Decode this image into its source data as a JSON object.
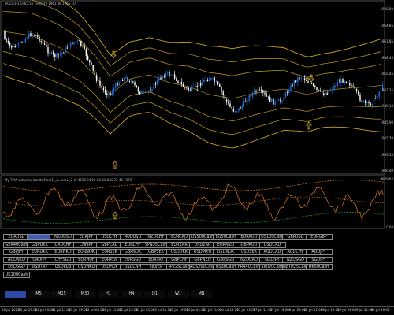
{
  "main_chart": {
    "title": "GOLD,H1 1965.56 1965.59 1963.88 1965.10",
    "price_scale": [
      "1968.00",
      "1964.85",
      "1961.85",
      "1958.45",
      "1955.45",
      "1952.25",
      "1949.10",
      "1945.90",
      "1942.70",
      "1939.55",
      "1936.40"
    ]
  },
  "indicator": {
    "title": "My TMA extremal bands Mod(1)_w Arrow_2 |0.4618 84.10 84.01 8.6272 45.7397",
    "scale": [
      "99.5802",
      "0.00"
    ]
  },
  "symbols": [
    "EURUSD",
    "GBPUSD",
    "NZDUSD",
    "EURJPY",
    "USDCHF",
    "AUDUSD",
    "NZDCHF",
    "EURCAD",
    "US500Cash",
    "EU50Cash",
    "EURAUD",
    "US100Cash",
    "GBPUSD",
    "EURGBP",
    "GER40Cash",
    "GBPDKK",
    "CADCHF",
    "CHFJPY",
    "GBPCAD",
    "EURCHF",
    "SPN35Cash",
    "EURZAR",
    "USDZAR",
    "EURNZD",
    "GBPAUD",
    "USDCAD",
    "GBPJPY",
    "EURDKK",
    "EURHKD",
    "EURNOK",
    "EURSEK",
    "GBPNOK",
    "GBPSEK",
    "USDDKK",
    "USDMXN",
    "USDNOK",
    "USDSEK",
    "AUDCAD",
    "AUDCHF",
    "AUDJPY",
    "AUDNZD",
    "CADJPY",
    "CHFSGD",
    "EURHUF",
    "EURPLN",
    "EURSGD",
    "EURTRY",
    "GBPCHF",
    "GBPNZD",
    "GBPSGD",
    "NZDCAD",
    "NZDJPY",
    "NZDSGD",
    "SGDJPY",
    "USDSGD",
    "USDTRY",
    "USDPLN",
    "USDHKD",
    "USDHUF",
    "USDCNH",
    "SILVER",
    "JP225Cash",
    "AUS200Cash",
    "US30Cash",
    "FRA40Cash",
    "SWI20Cash",
    "NETH25Cash",
    "HK50Cash",
    "UK100Cash"
  ],
  "active_symbol_index": 1,
  "timeframes": [
    "M1",
    "M5",
    "M15",
    "M30",
    "H1",
    "H4",
    "D1",
    "W1",
    "MN"
  ],
  "active_timeframe_index": 0,
  "time_labels": [
    "10 Jul 2023",
    "10 Jul 19:00",
    "11 Jul 03:00",
    "11 Jul 11:00",
    "11 Jul 19:00",
    "12 Jul 03:00",
    "12 Jul 11:00",
    "12 Jul 19:00",
    "13 Jul 03:00",
    "13 Jul 11:00",
    "13 Jul 19:00",
    "14 Jul 03:00",
    "14 Jul 11:00",
    "14 Jul 19:00",
    "17 Jul 03:00",
    "17 Jul 11:00",
    "17 Jul 19:00",
    "18 Jul 03:00",
    "18 Jul 11:00",
    "18 Jul 19:00",
    "19 Jul 03:00",
    "19 Jul 11:00",
    "19 Jul 19:00"
  ],
  "colors": {
    "band": "#c8a020",
    "candle_up": "#1e6fe0",
    "candle_down": "#ffffff",
    "ind_orange": "#e07a20",
    "ind_green": "#20a040",
    "arrow": "#e0b030",
    "grid": "#888888"
  },
  "icons": [
    "arrow-up-icon",
    "arrow-down-icon"
  ]
}
